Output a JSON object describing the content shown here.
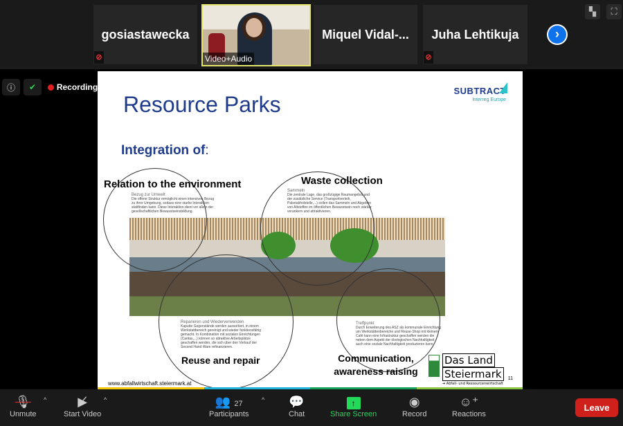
{
  "participants": [
    {
      "name": "gosiastawecka"
    },
    {
      "name": "Video+Audio"
    },
    {
      "name": "Miquel Vidal-..."
    },
    {
      "name": "Juha Lehtikuja"
    }
  ],
  "status": {
    "recording": "Recording"
  },
  "slide": {
    "title": "Resource Parks",
    "subtitle": "Integration of",
    "subtitle_suffix": ":",
    "logo": {
      "name": "SUBTRACT",
      "tag": "Interreg Europe"
    },
    "sections": [
      {
        "heading": "Relation to the environment",
        "de_title": "Bezug zur Umwelt",
        "de_text": "Die offene Struktur ermöglicht einen intensiven Bezug zu ihrer Umgebung, sodass eine starke Interaktion stattfinden kann. Diese Interaktion dient vor allem der gesellschaftlichen Bewusstseinsbildung."
      },
      {
        "heading": "Waste collection",
        "de_title": "Sammeln",
        "de_text": "Die zentrale Lage, das großzügige Raumangebot und der zusätzliche Service (Transportverleih, Paketabholstelle,...) sollen das Sammeln und Abgeben von Altstoffen im öffentlichen Bewusstsein noch stärker verankern und attraktivieren."
      },
      {
        "heading": "Reuse and repair",
        "de_title": "Reparieren und Wiederverwenden",
        "de_text": "Kaputte Gegenstände werden aussortiert, in einem Werkstattbereich gereinigt und wieder funktionsfähig gemacht. In Kombination mit sozialen Einrichtungen (Caritas,...) können so attraktive Arbeitsplätze geschaffen werden, die sich über den Verkauf der Second Hand Ware refinanzieren."
      },
      {
        "heading": "Communication, awareness raising",
        "de_title": "Treffpunkt",
        "de_text": "Durch Erweiterung des ASZ als kommunale Einrichtung um Werkstättenbereiche und Reuse-Shop mit kleinem Café kann eine Infrastruktur geschaffen werden die neben dem Aspekt der ökologischen Nachhaltigkeit auch eine soziale Nachhaltigkeit produzieren kann."
      }
    ],
    "footer_url": "www.abfallwirtschaft.steiermark.at",
    "page_number": "11",
    "land_logo": {
      "line1": "Das Land",
      "line2": "Steiermark",
      "line3": "Abfall- und Ressourcenwirtschaft"
    },
    "footer_colors": [
      "#f5c400",
      "#1bb3d9",
      "#13a05a",
      "#8cc63f"
    ]
  },
  "toolbar": {
    "unmute": "Unmute",
    "start_video": "Start Video",
    "participants": "Participants",
    "participant_count": "27",
    "chat": "Chat",
    "share_screen": "Share Screen",
    "record": "Record",
    "reactions": "Reactions",
    "leave": "Leave"
  },
  "colors": {
    "share_accent": "#23d959",
    "leave": "#d0201b",
    "active_speaker": "#e4e66b"
  }
}
